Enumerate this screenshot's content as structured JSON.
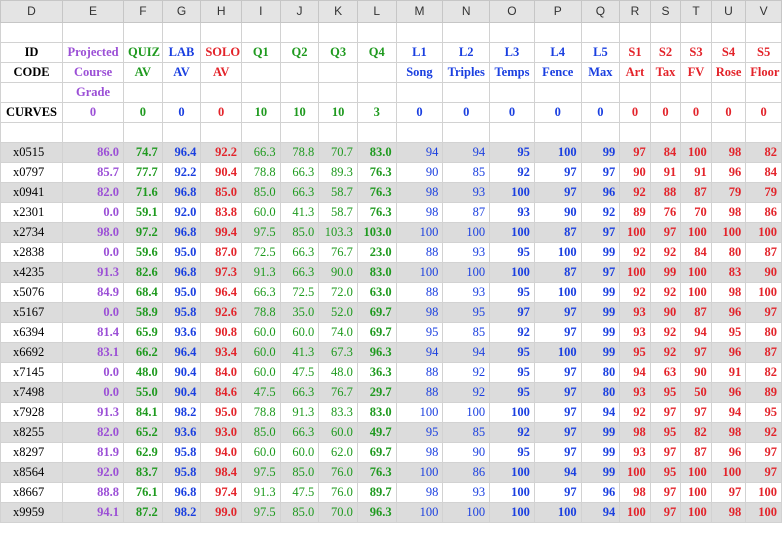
{
  "columns": [
    "D",
    "E",
    "F",
    "G",
    "H",
    "I",
    "J",
    "K",
    "L",
    "M",
    "N",
    "O",
    "P",
    "Q",
    "R",
    "S",
    "T",
    "U",
    "V"
  ],
  "header_row1": [
    "ID",
    "Projected",
    "QUIZ",
    "LAB",
    "SOLO",
    "Q1",
    "Q2",
    "Q3",
    "Q4",
    "L1",
    "L2",
    "L3",
    "L4",
    "L5",
    "S1",
    "S2",
    "S3",
    "S4",
    "S5"
  ],
  "header_row2": [
    "CODE",
    "Course",
    "AV",
    "AV",
    "AV",
    "",
    "",
    "",
    "",
    "Song",
    "Triples",
    "Temps",
    "Fence",
    "Max",
    "Art",
    "Tax",
    "FV",
    "Rose",
    "Floor"
  ],
  "header_row3": [
    "",
    "Grade",
    "",
    "",
    "",
    "",
    "",
    "",
    "",
    "",
    "",
    "",
    "",
    "",
    "",
    "",
    "",
    "",
    ""
  ],
  "curves": [
    "CURVES",
    "0",
    "0",
    "0",
    "0",
    "10",
    "10",
    "10",
    "3",
    "0",
    "0",
    "0",
    "0",
    "0",
    "0",
    "0",
    "0",
    "0",
    "0"
  ],
  "rows": [
    [
      "x0515",
      "86.0",
      "74.7",
      "96.4",
      "92.2",
      "66.3",
      "78.8",
      "70.7",
      "83.0",
      "94",
      "94",
      "95",
      "100",
      "99",
      "97",
      "84",
      "100",
      "98",
      "82"
    ],
    [
      "x0797",
      "85.7",
      "77.7",
      "92.2",
      "90.4",
      "78.8",
      "66.3",
      "89.3",
      "76.3",
      "90",
      "85",
      "92",
      "97",
      "97",
      "90",
      "91",
      "91",
      "96",
      "84"
    ],
    [
      "x0941",
      "82.0",
      "71.6",
      "96.8",
      "85.0",
      "85.0",
      "66.3",
      "58.7",
      "76.3",
      "98",
      "93",
      "100",
      "97",
      "96",
      "92",
      "88",
      "87",
      "79",
      "79"
    ],
    [
      "x2301",
      "0.0",
      "59.1",
      "92.0",
      "83.8",
      "60.0",
      "41.3",
      "58.7",
      "76.3",
      "98",
      "87",
      "93",
      "90",
      "92",
      "89",
      "76",
      "70",
      "98",
      "86"
    ],
    [
      "x2734",
      "98.0",
      "97.2",
      "96.8",
      "99.4",
      "97.5",
      "85.0",
      "103.3",
      "103.0",
      "100",
      "100",
      "100",
      "87",
      "97",
      "100",
      "97",
      "100",
      "100",
      "100"
    ],
    [
      "x2838",
      "0.0",
      "59.6",
      "95.0",
      "87.0",
      "72.5",
      "66.3",
      "76.7",
      "23.0",
      "88",
      "93",
      "95",
      "100",
      "99",
      "92",
      "92",
      "84",
      "80",
      "87"
    ],
    [
      "x4235",
      "91.3",
      "82.6",
      "96.8",
      "97.3",
      "91.3",
      "66.3",
      "90.0",
      "83.0",
      "100",
      "100",
      "100",
      "87",
      "97",
      "100",
      "99",
      "100",
      "83",
      "90"
    ],
    [
      "x5076",
      "84.9",
      "68.4",
      "95.0",
      "96.4",
      "66.3",
      "72.5",
      "72.0",
      "63.0",
      "88",
      "93",
      "95",
      "100",
      "99",
      "92",
      "92",
      "100",
      "98",
      "100"
    ],
    [
      "x5167",
      "0.0",
      "58.9",
      "95.8",
      "92.6",
      "78.8",
      "35.0",
      "52.0",
      "69.7",
      "98",
      "95",
      "97",
      "97",
      "99",
      "93",
      "90",
      "87",
      "96",
      "97"
    ],
    [
      "x6394",
      "81.4",
      "65.9",
      "93.6",
      "90.8",
      "60.0",
      "60.0",
      "74.0",
      "69.7",
      "95",
      "85",
      "92",
      "97",
      "99",
      "93",
      "92",
      "94",
      "95",
      "80"
    ],
    [
      "x6692",
      "83.1",
      "66.2",
      "96.4",
      "93.4",
      "60.0",
      "41.3",
      "67.3",
      "96.3",
      "94",
      "94",
      "95",
      "100",
      "99",
      "95",
      "92",
      "97",
      "96",
      "87"
    ],
    [
      "x7145",
      "0.0",
      "48.0",
      "90.4",
      "84.0",
      "60.0",
      "47.5",
      "48.0",
      "36.3",
      "88",
      "92",
      "95",
      "97",
      "80",
      "94",
      "63",
      "90",
      "91",
      "82"
    ],
    [
      "x7498",
      "0.0",
      "55.0",
      "90.4",
      "84.6",
      "47.5",
      "66.3",
      "76.7",
      "29.7",
      "88",
      "92",
      "95",
      "97",
      "80",
      "93",
      "95",
      "50",
      "96",
      "89"
    ],
    [
      "x7928",
      "91.3",
      "84.1",
      "98.2",
      "95.0",
      "78.8",
      "91.3",
      "83.3",
      "83.0",
      "100",
      "100",
      "100",
      "97",
      "94",
      "92",
      "97",
      "97",
      "94",
      "95"
    ],
    [
      "x8255",
      "82.0",
      "65.2",
      "93.6",
      "93.0",
      "85.0",
      "66.3",
      "60.0",
      "49.7",
      "95",
      "85",
      "92",
      "97",
      "99",
      "98",
      "95",
      "82",
      "98",
      "92"
    ],
    [
      "x8297",
      "81.9",
      "62.9",
      "95.8",
      "94.0",
      "60.0",
      "60.0",
      "62.0",
      "69.7",
      "98",
      "90",
      "95",
      "97",
      "99",
      "93",
      "97",
      "87",
      "96",
      "97"
    ],
    [
      "x8564",
      "92.0",
      "83.7",
      "95.8",
      "98.4",
      "97.5",
      "85.0",
      "76.0",
      "76.3",
      "100",
      "86",
      "100",
      "94",
      "99",
      "100",
      "95",
      "100",
      "100",
      "97"
    ],
    [
      "x8667",
      "88.8",
      "76.1",
      "96.8",
      "97.4",
      "91.3",
      "47.5",
      "76.0",
      "89.7",
      "98",
      "93",
      "100",
      "97",
      "96",
      "98",
      "97",
      "100",
      "97",
      "100"
    ],
    [
      "x9959",
      "94.1",
      "87.2",
      "98.2",
      "99.0",
      "97.5",
      "85.0",
      "70.0",
      "96.3",
      "100",
      "100",
      "100",
      "100",
      "94",
      "100",
      "97",
      "100",
      "98",
      "100"
    ]
  ],
  "colors": {
    "purple": "#9b4fd6",
    "green": "#1f9a1f",
    "blue": "#1a3fe0",
    "red": "#e3232a"
  }
}
